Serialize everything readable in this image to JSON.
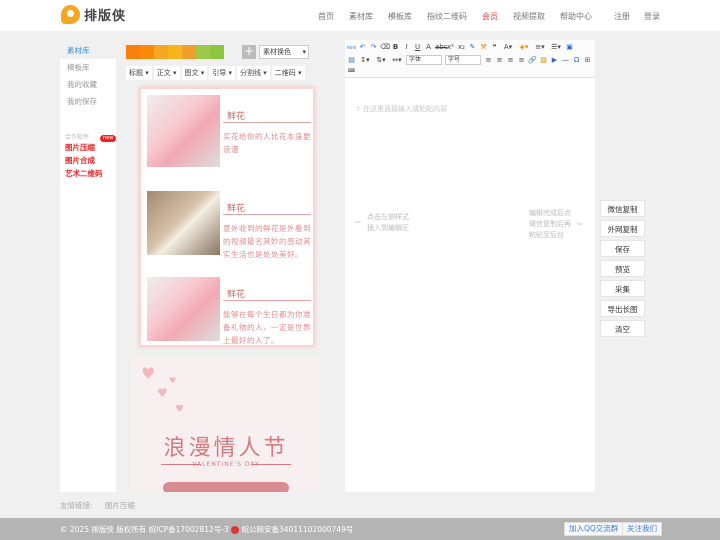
{
  "header": {
    "logo_text": "排版侠",
    "nav": [
      {
        "label": "首页",
        "active": false
      },
      {
        "label": "素材库",
        "active": false
      },
      {
        "label": "模板库",
        "active": false
      },
      {
        "label": "指纹二维码",
        "active": false
      },
      {
        "label": "会员",
        "active": true
      },
      {
        "label": "视频提取",
        "active": false
      },
      {
        "label": "帮助中心",
        "active": false
      }
    ],
    "register": "注册",
    "login": "登录"
  },
  "sidebar": {
    "items": [
      "素材库",
      "模板库",
      "我的收藏",
      "我的保存"
    ],
    "group_label": "合作软件",
    "tools": [
      "图片压缩",
      "图片合成",
      "艺术二维码"
    ],
    "badge": "new"
  },
  "material": {
    "swatch_colors": [
      "#f97f0f",
      "#fa8a0a",
      "#f5a623",
      "#f6b51b",
      "#f0a02a",
      "#9cc94a",
      "#8cc63f"
    ],
    "add_label": "+",
    "color_select": "素材换色",
    "tabs": [
      "标题 ▾",
      "正文 ▾",
      "图文 ▾",
      "引导 ▾",
      "分割线 ▾",
      "二维码 ▾"
    ],
    "items": [
      {
        "title": "鲜花",
        "desc": "买花给你的人比花本身更浪漫"
      },
      {
        "title": "鲜花",
        "desc": "意外收到的鲜花是外看到的视频最名其妙的感动其实生活也是处处美好。"
      },
      {
        "title": "鲜花",
        "desc": "能够在每个生日都为你准备礼物的人，一定是世界上最好的人了。"
      }
    ],
    "banner": {
      "title": "浪漫情人节",
      "subtitle": "VALENTINE'S DAY"
    }
  },
  "editor": {
    "font_select": "字体",
    "size_select": "字号",
    "hint": "在这里直接输入或粘贴内容",
    "left_hint_1": "点击左侧样式",
    "left_hint_2": "插入到编辑区",
    "right_hint_1": "编辑完成后点",
    "right_hint_2": "微信复制后再",
    "right_hint_3": "粘贴至后台"
  },
  "actions": [
    "微信复制",
    "外网复制",
    "保存",
    "预览",
    "采集",
    "导出长图",
    "清空"
  ],
  "links": {
    "label": "友情链接:",
    "items": [
      "图片压缩"
    ]
  },
  "footer": {
    "copyright": "© 2025 排版侠 版权所有 皖ICP备17002812号-3",
    "police": "皖公网安备34011102000749号",
    "qq_button": "加入QQ交流群",
    "follow_button": "关注我们"
  }
}
